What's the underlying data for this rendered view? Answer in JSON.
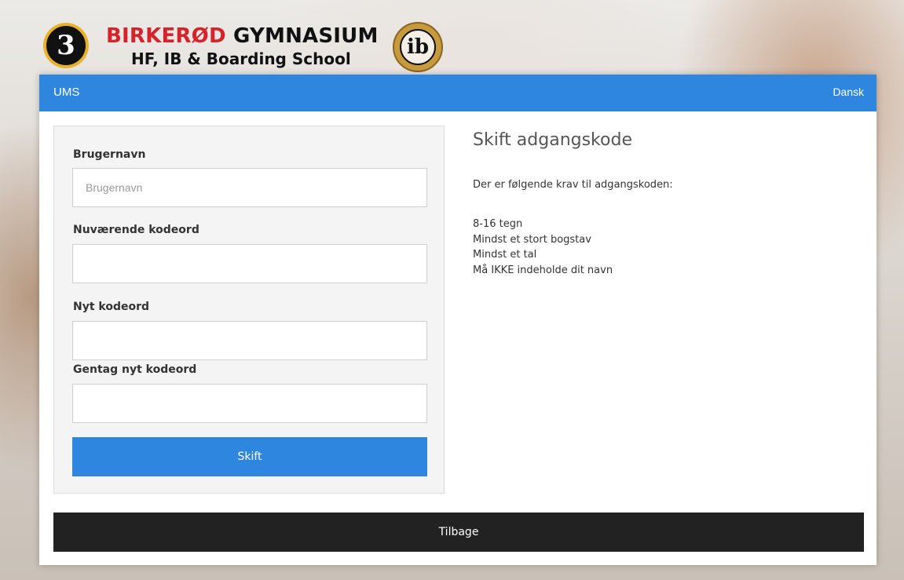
{
  "header": {
    "school_name_red": "BIRKERØD",
    "school_name_black": "GYMNASIUM",
    "school_sub": "HF, IB & Boarding School",
    "logo_left_glyph": "3",
    "logo_ib_glyph": "ib"
  },
  "navbar": {
    "brand": "UMS",
    "language": "Dansk",
    "color": "#2f86de"
  },
  "form": {
    "username_label": "Brugernavn",
    "username_placeholder": "Brugernavn",
    "username_value": "",
    "current_password_label": "Nuværende kodeord",
    "new_password_label": "Nyt kodeord",
    "repeat_password_label": "Gentag nyt kodeord",
    "submit_label": "Skift"
  },
  "info": {
    "title": "Skift adgangskode",
    "intro": "Der er følgende krav til adgangskoden:",
    "requirements": [
      "8-16 tegn",
      "Mindst et stort bogstav",
      "Mindst et tal",
      "Må IKKE indeholde dit navn"
    ]
  },
  "footer": {
    "back_label": "Tilbage"
  }
}
